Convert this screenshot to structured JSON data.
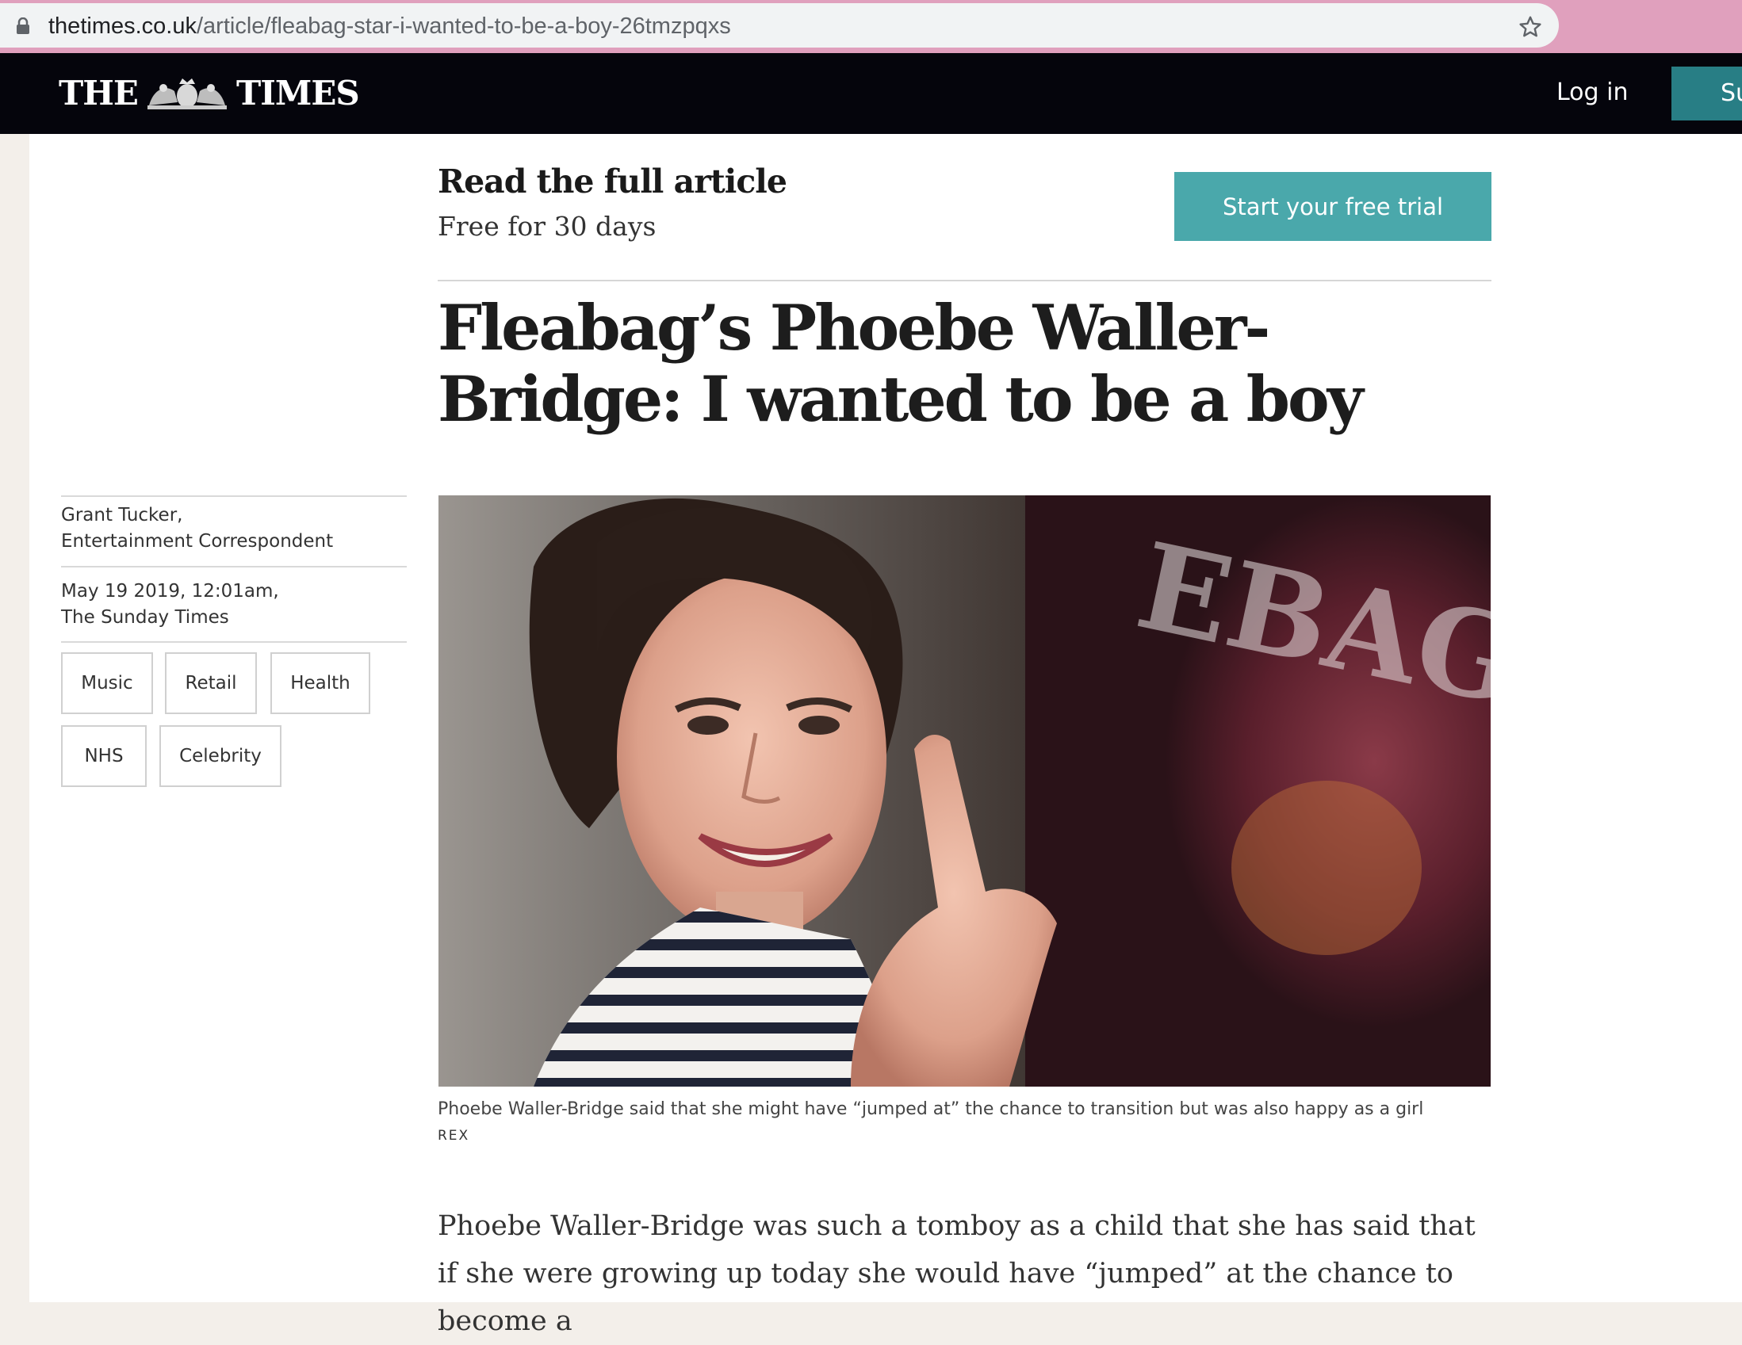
{
  "browser": {
    "url_host": "thetimes.co.uk",
    "url_path": "/article/fleabag-star-i-wanted-to-be-a-boy-26tmzpqxs"
  },
  "header": {
    "logo_left": "THE",
    "logo_right": "TIMES",
    "login_label": "Log in",
    "subscribe_label": "Su",
    "background": "#05050c",
    "subscribe_color": "#287e85"
  },
  "promo": {
    "title": "Read the full article",
    "subtitle": "Free for 30 days",
    "button_label": "Start your free trial",
    "button_color": "#4aa8ab"
  },
  "article": {
    "headline": "Fleabag’s Phoebe Waller-Bridge: I wanted to be a boy",
    "byline_name": "Grant Tucker,",
    "byline_role": "Entertainment Correspondent",
    "date": "May 19 2019, 12:01am,",
    "publication": "The Sunday Times",
    "tags": [
      "Music",
      "Retail",
      "Health",
      "NHS",
      "Celebrity"
    ],
    "caption": "Phoebe Waller-Bridge said that she might have “jumped at” the chance to transition but was also happy as a girl",
    "credit": "REX",
    "body": "Phoebe Waller-Bridge was such a tomboy as a child that she has said that if she were growing up today she would have “jumped” at the chance to become a"
  }
}
